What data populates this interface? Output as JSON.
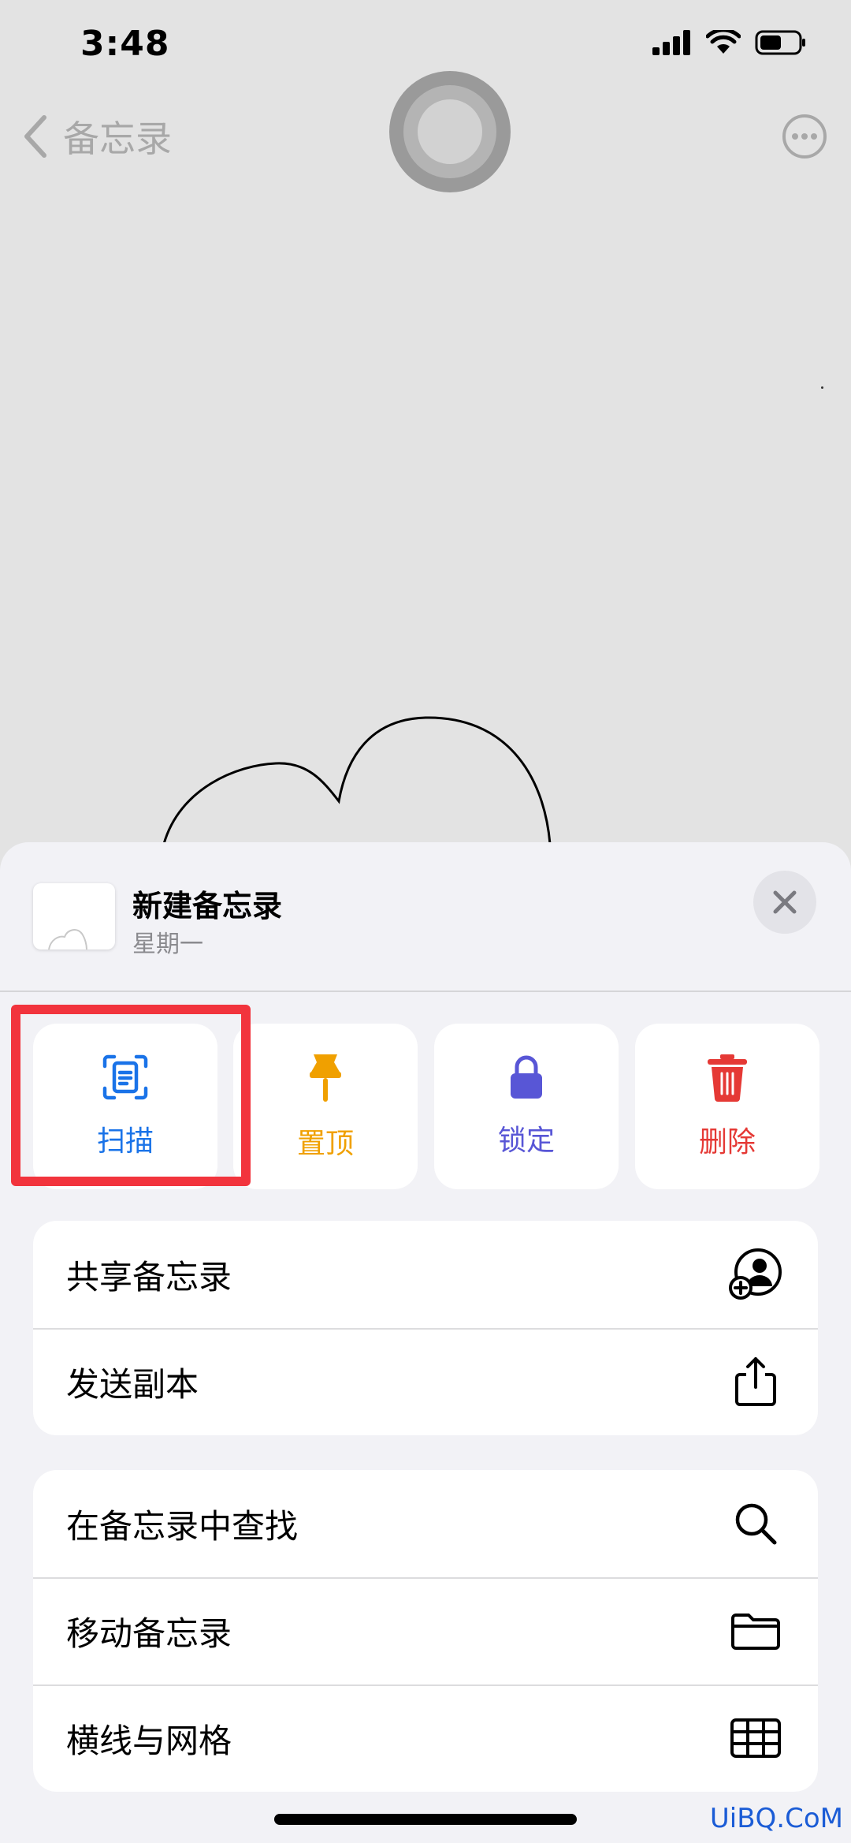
{
  "status_bar": {
    "time": "3:48"
  },
  "nav": {
    "back_label": "备忘录"
  },
  "sheet": {
    "title": "新建备忘录",
    "subtitle": "星期一"
  },
  "actions": [
    {
      "label": "扫描",
      "icon": "scan-icon",
      "color": "#1a73e8"
    },
    {
      "label": "置顶",
      "icon": "pin-icon",
      "color": "#f0a000"
    },
    {
      "label": "锁定",
      "icon": "lock-icon",
      "color": "#5856d6"
    },
    {
      "label": "删除",
      "icon": "trash-icon",
      "color": "#e53935"
    }
  ],
  "group1": [
    {
      "label": "共享备忘录",
      "icon": "share-person-icon"
    },
    {
      "label": "发送副本",
      "icon": "share-upload-icon"
    }
  ],
  "group2": [
    {
      "label": "在备忘录中查找",
      "icon": "search-icon"
    },
    {
      "label": "移动备忘录",
      "icon": "folder-icon"
    },
    {
      "label": "横线与网格",
      "icon": "grid-icon"
    }
  ],
  "watermark": "UiBQ.CoM"
}
